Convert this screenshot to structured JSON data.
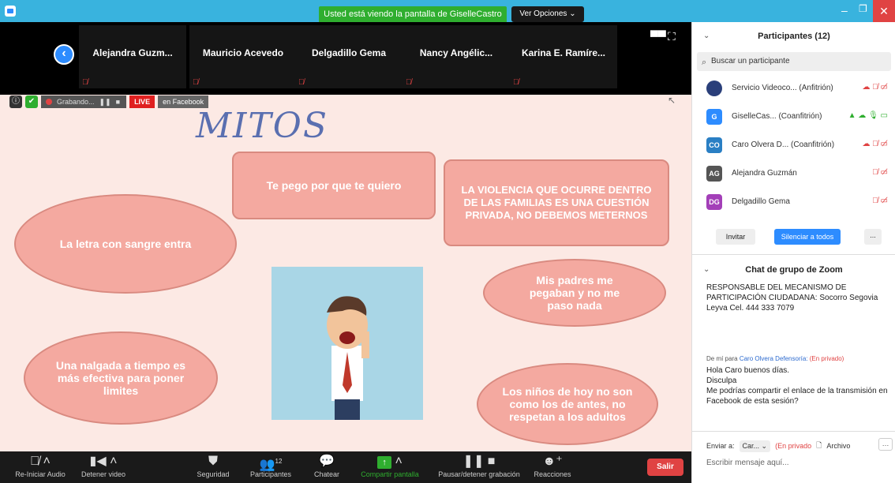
{
  "window": {
    "viewing_label": "Usted está viendo la pantalla de GiselleCastro",
    "view_options": "Ver Opciones ⌄",
    "minimize": "–",
    "maximize": "❐",
    "close": "✕"
  },
  "strip": {
    "participants": [
      {
        "name": "Alejandra Guzm..."
      },
      {
        "name": "Mauricio Acevedo"
      },
      {
        "name": "Delgadillo Gema"
      },
      {
        "name": "Nancy Angélic..."
      },
      {
        "name": "Karina E. Ramíre..."
      }
    ]
  },
  "recording": {
    "status": "Grabando...",
    "live": "LIVE",
    "platform": "en Facebook"
  },
  "slide": {
    "title": "MITOS",
    "bubbles": {
      "b1": "Te pego por que te quiero",
      "b2": "LA VIOLENCIA QUE OCURRE DENTRO DE LAS FAMILIAS ES UNA CUESTIÓN PRIVADA, NO DEBEMOS METERNOS",
      "b3": "La letra con sangre entra",
      "b4": "Mis padres me pegaban y no me paso nada",
      "b5": "Una nalgada a tiempo es más efectiva para poner limites",
      "b6": "Los niños de hoy no son como los de antes, no respetan a los adultos"
    }
  },
  "toolbar": {
    "audio": "Re-Iniciar Audio",
    "video": "Detener video",
    "security": "Seguridad",
    "participants": "Participantes",
    "participants_count": "12",
    "chat": "Chatear",
    "share": "Compartir pantalla",
    "recording": "Pausar/detener grabación",
    "reactions": "Reacciones",
    "leave": "Salir"
  },
  "panel": {
    "title": "Participantes (12)",
    "search_placeholder": "Buscar un participante",
    "participants": [
      {
        "initials": "",
        "name": "Servicio Videoco...  (Anfitrión)",
        "color": "#2a3f7a"
      },
      {
        "initials": "G",
        "name": "GiselleCas...  (Coanfitrión)",
        "color": "#2d8cff"
      },
      {
        "initials": "CO",
        "name": "Caro Olvera D...  (Coanfitrión)",
        "color": "#2a7fc4"
      },
      {
        "initials": "AG",
        "name": "Alejandra Guzmán",
        "color": "#555555"
      },
      {
        "initials": "DG",
        "name": "Delgadillo Gema",
        "color": "#a33fb8"
      }
    ],
    "invite": "Invitar",
    "mute_all": "Silenciar a todos",
    "more": "...",
    "chat_title": "Chat de grupo de Zoom",
    "chat_msg1": "RESPONSABLE DEL MECANISMO DE PARTICIPACIÓN CIUDADANA: Socorro Segovia Leyva  Cel. 444 333 7079",
    "chat_meta_from": "De mí para",
    "chat_meta_to": "Caro Olvera Defensoría:",
    "chat_meta_private": "(En privado)",
    "chat_msg2_l1": "Hola Caro buenos días.",
    "chat_msg2_l2": "Disculpa",
    "chat_msg2_l3": "Me podrías compartir el enlace de la transmisión en Facebook de esta sesión?",
    "send_to_label": "Enviar a:",
    "send_to_value": "Car... ⌄",
    "send_private": "(En privado",
    "file": "Archivo",
    "input_placeholder": "Escribir mensaje aquí..."
  }
}
